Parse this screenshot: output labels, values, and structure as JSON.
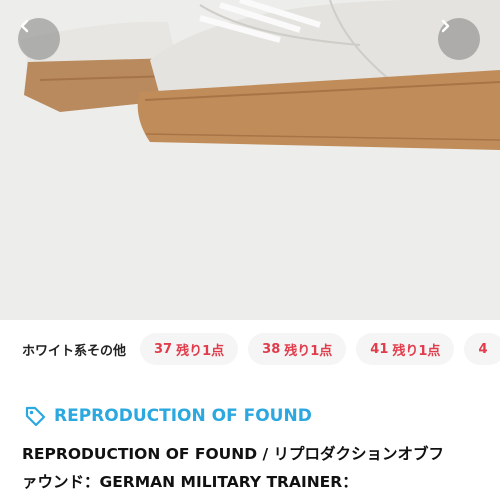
{
  "gallery": {
    "prev_icon": "chevron-left-icon",
    "next_icon": "chevron-right-icon",
    "image_alt": "white suede trainer with gum sole"
  },
  "variants": {
    "label": "ホワイト系その他",
    "items": [
      {
        "size": "37",
        "stock": "残り1点"
      },
      {
        "size": "38",
        "stock": "残り1点"
      },
      {
        "size": "41",
        "stock": "残り1点"
      },
      {
        "size": "4",
        "stock": ""
      }
    ],
    "accent_color": "#e03c4b"
  },
  "product": {
    "brand_icon": "tag-icon",
    "brand": "REPRODUCTION OF FOUND",
    "brand_color": "#2ba8df",
    "title_line1": "REPRODUCTION OF FOUND / リプロダクションオブフ",
    "title_line2": "ァウンド：GERMAN MILITARY TRAINER："
  }
}
